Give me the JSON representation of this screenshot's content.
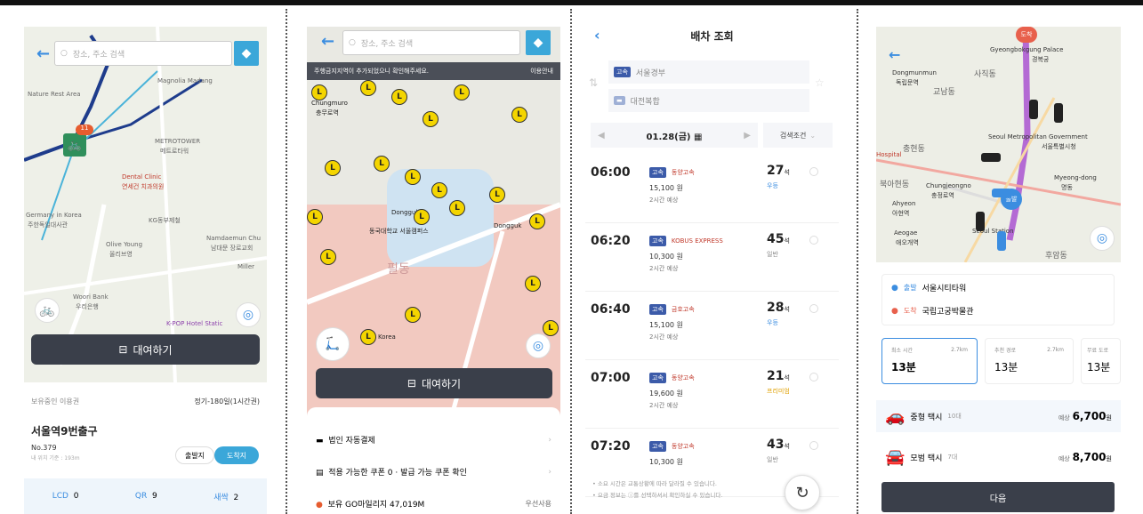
{
  "panel1": {
    "search_placeholder": "장소, 주소 검색",
    "map_labels": [
      "Nature Rest Area",
      "Magnolia Madang",
      "METROTOWER",
      "메트로타워",
      "Dental Clinic",
      "연세건 치과의원",
      "Germany in Korea",
      "주한독일대사관",
      "KG동부제철",
      "Olive Young",
      "올리브영",
      "Namdaemun Chu",
      "남대문 장로교회",
      "Woori Bank",
      "우리은행",
      "K-POP Hotel Static",
      "Miller"
    ],
    "rent_button": "대여하기",
    "pass_label": "보유중인 이용권",
    "pass_value": "정기-180일(1시간권)",
    "station_name": "서울역9번출구",
    "station_no": "No.379",
    "station_dist": "내 위치 기준 : 193m",
    "depart_btn": "출발지",
    "arrive_btn": "도착지",
    "stats": [
      {
        "label": "LCD",
        "value": "0"
      },
      {
        "label": "QR",
        "value": "9"
      },
      {
        "label": "새싹",
        "value": "2"
      }
    ],
    "colors": {
      "accent": "#3ba7d9",
      "route": "#1e3c8c",
      "bike": "#2f8f5b"
    }
  },
  "panel2": {
    "search_placeholder": "장소, 주소 검색",
    "notice": "주행금지지역이 추가되었으니 확인해주세요.",
    "notice_link": "이용안내",
    "map_labels": [
      "Chungmuro",
      "충무로역",
      "Dongguk",
      "동국대학교 서울캠퍼스",
      "필동",
      "Dongguk",
      "Korea"
    ],
    "rent_button": "대여하기",
    "menu": [
      {
        "icon": "card-icon",
        "label": "법인 자동결제"
      },
      {
        "icon": "coupon-icon",
        "label": "적용 가능한 쿠폰 0 · 발급 가능 쿠폰 확인"
      },
      {
        "icon": "mileage-icon",
        "label": "보유 GO마일리지 47,019M",
        "right": "우선사용"
      }
    ]
  },
  "panel3": {
    "title": "배차 조회",
    "from": "서울경부",
    "to": "대전복합",
    "date": "01.28(금)",
    "filter": "검색조건",
    "schedules": [
      {
        "time": "06:00",
        "grade": "고속",
        "company": "동양고속",
        "price": "15,100 원",
        "duration": "2시간 예상",
        "seats": "27",
        "unit": "석",
        "type": "우등"
      },
      {
        "time": "06:20",
        "grade": "고속",
        "company": "KOBUS EXPRESS",
        "price": "10,300 원",
        "duration": "2시간 예상",
        "seats": "45",
        "unit": "석",
        "type": "일반"
      },
      {
        "time": "06:40",
        "grade": "고속",
        "company": "금호고속",
        "price": "15,100 원",
        "duration": "2시간 예상",
        "seats": "28",
        "unit": "석",
        "type": "우등"
      },
      {
        "time": "07:00",
        "grade": "고속",
        "company": "동양고속",
        "price": "19,600 원",
        "duration": "2시간 예상",
        "seats": "21",
        "unit": "석",
        "type": "프리미엄"
      },
      {
        "time": "07:20",
        "grade": "고속",
        "company": "동양고속",
        "price": "10,300 원",
        "duration": "",
        "seats": "43",
        "unit": "석",
        "type": "일반"
      }
    ],
    "notes": [
      "• 소요 시간은 교통상황에 따라 달라질 수 있습니다.",
      "• 요금 정보는 ⓘ를 선택하셔서 확인하실 수 있습니다."
    ]
  },
  "panel4": {
    "map_labels": [
      "Gyeongbokgung Palace",
      "경복궁",
      "Dongmunmun",
      "독립문역",
      "사직동",
      "교남동",
      "Seoul Metropolitan Government",
      "서울특별시청",
      "충현동",
      "북아현동",
      "Chungjeongno",
      "충정로역",
      "Ahyeon",
      "아현역",
      "Myeong-dong",
      "명동",
      "Aeogae",
      "애오개역",
      "Seoul Station",
      "Hospital",
      "후암동"
    ],
    "dest_pin": "도착",
    "start_pin": "출발",
    "origin_tag": "출발",
    "origin": "서울시티타워",
    "dest_tag": "도착",
    "destination": "국립고궁박물관",
    "routes": [
      {
        "name": "최소 시간",
        "dist": "2.7km",
        "time": "13분"
      },
      {
        "name": "추천 경로",
        "dist": "2.7km",
        "time": "13분"
      },
      {
        "name": "무료 도로",
        "dist": "",
        "time": "13분"
      }
    ],
    "taxis": [
      {
        "name": "중형 택시",
        "count": "10대",
        "price_label": "예상",
        "price": "6,700",
        "unit": "원"
      },
      {
        "name": "모범 택시",
        "count": "7대",
        "price_label": "예상",
        "price": "8,700",
        "unit": "원"
      }
    ],
    "next_button": "다음"
  }
}
